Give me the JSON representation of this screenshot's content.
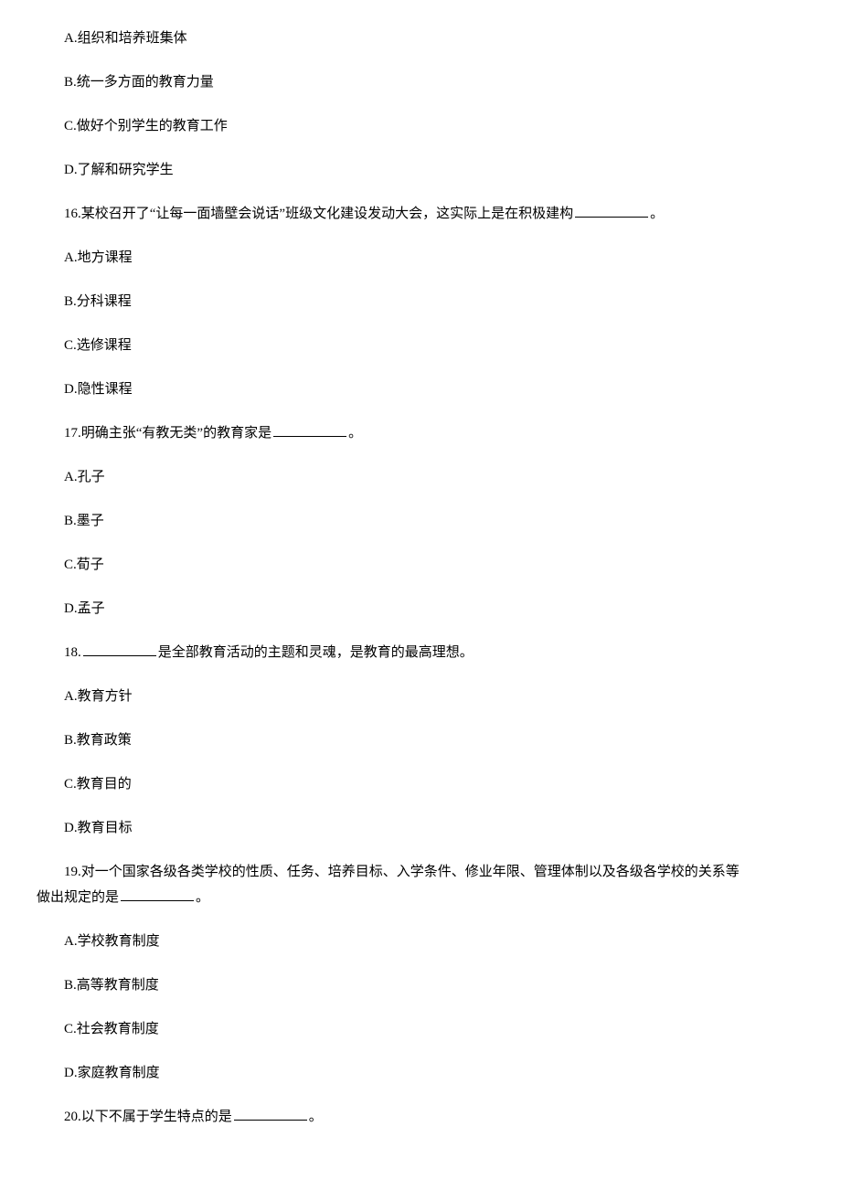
{
  "q15": {
    "optA": "A.组织和培养班集体",
    "optB": "B.统一多方面的教育力量",
    "optC": "C.做好个别学生的教育工作",
    "optD": "D.了解和研究学生"
  },
  "q16": {
    "stem_pre": "16.某校召开了“让每一面墙壁会说话”班级文化建设发动大会，这实际上是在积极建构",
    "stem_post": "。",
    "optA": "A.地方课程",
    "optB": "B.分科课程",
    "optC": "C.选修课程",
    "optD": "D.隐性课程"
  },
  "q17": {
    "stem_pre": "17.明确主张“有教无类”的教育家是",
    "stem_post": "。",
    "optA": "A.孔子",
    "optB": "B.墨子",
    "optC": "C.荀子",
    "optD": "D.孟子"
  },
  "q18": {
    "stem_pre": "18.",
    "stem_post": "是全部教育活动的主题和灵魂，是教育的最高理想。",
    "optA": "A.教育方针",
    "optB": "B.教育政策",
    "optC": "C.教育目的",
    "optD": "D.教育目标"
  },
  "q19": {
    "stem_line1": "19.对一个国家各级各类学校的性质、任务、培养目标、入学条件、修业年限、管理体制以及各级各学校的关系等",
    "stem_line2_pre": "做出规定的是",
    "stem_line2_post": "。",
    "optA": "A.学校教育制度",
    "optB": "B.高等教育制度",
    "optC": "C.社会教育制度",
    "optD": "D.家庭教育制度"
  },
  "q20": {
    "stem_pre": "20.以下不属于学生特点的是",
    "stem_post": "。"
  }
}
